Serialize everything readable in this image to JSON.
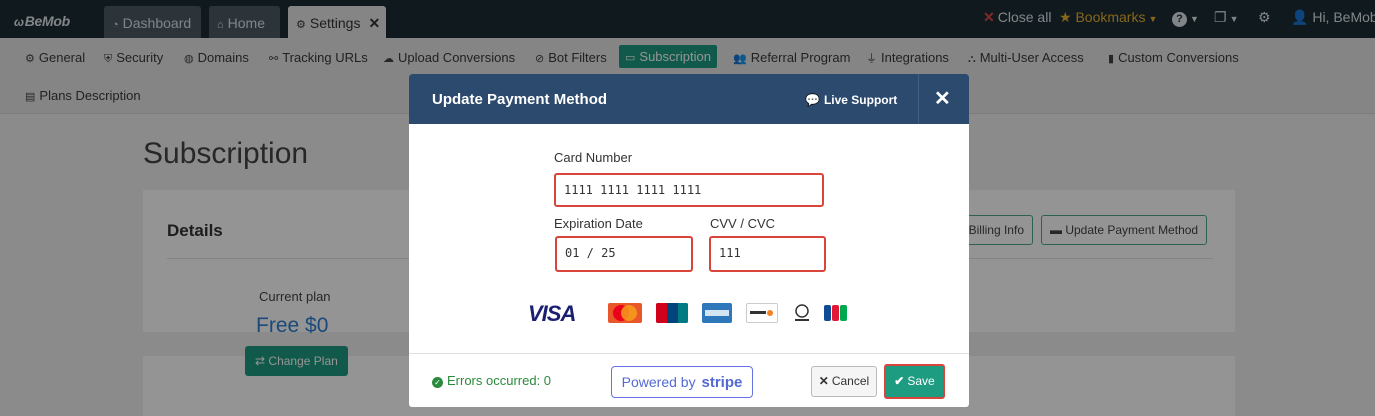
{
  "app": {
    "logo": "BeMob"
  },
  "tabs": [
    {
      "label": "Dashboard",
      "icon": "dashboard-icon"
    },
    {
      "label": "Home",
      "icon": "home-icon"
    },
    {
      "label": "Settings",
      "icon": "gear-icon",
      "active": true
    }
  ],
  "topright": {
    "close_all": "Close all",
    "bookmarks": "Bookmarks",
    "user": "Hi, BeMob"
  },
  "subnav": [
    {
      "label": "General",
      "icon": "gear-icon"
    },
    {
      "label": "Security",
      "icon": "shield-icon"
    },
    {
      "label": "Domains",
      "icon": "globe-icon"
    },
    {
      "label": "Tracking URLs",
      "icon": "link-icon"
    },
    {
      "label": "Upload Conversions",
      "icon": "cloud-upload-icon"
    },
    {
      "label": "Bot Filters",
      "icon": "ban-icon"
    },
    {
      "label": "Subscription",
      "icon": "credit-card-icon",
      "active": true
    },
    {
      "label": "Referral Program",
      "icon": "users-icon"
    },
    {
      "label": "Integrations",
      "icon": "plug-icon"
    },
    {
      "label": "Multi-User Access",
      "icon": "sitemap-icon"
    },
    {
      "label": "Custom Conversions",
      "icon": "file-icon"
    },
    {
      "label": "Plans Description",
      "icon": "file-text-icon"
    }
  ],
  "page": {
    "title": "Subscription",
    "details_title": "Details",
    "current_plan_label": "Current plan",
    "current_plan_value": "Free $0",
    "change_plan": "Change Plan",
    "billing_info": "Billing Info",
    "update_payment_method": "Update Payment Method"
  },
  "modal": {
    "title": "Update Payment Method",
    "live_support": "Live Support",
    "card_number_label": "Card Number",
    "card_number_value": "1111 1111 1111 1111",
    "expiration_label": "Expiration Date",
    "expiration_value": "01 / 25",
    "cvv_label": "CVV / CVC",
    "cvv_value": "111",
    "card_brands": [
      "VISA",
      "MasterCard",
      "UnionPay",
      "American Express",
      "DISCOVER",
      "Diners Club",
      "JCB"
    ],
    "errors": "Errors occurred: 0",
    "powered_by": "Powered by",
    "stripe": "stripe",
    "cancel": "Cancel",
    "save": "Save"
  },
  "colors": {
    "topbar": "#1d2c35",
    "accent_green": "#1e9c82",
    "modal_header": "#2c4a6e",
    "error_outline": "#d9453b",
    "plan_blue": "#2f7fd2"
  }
}
